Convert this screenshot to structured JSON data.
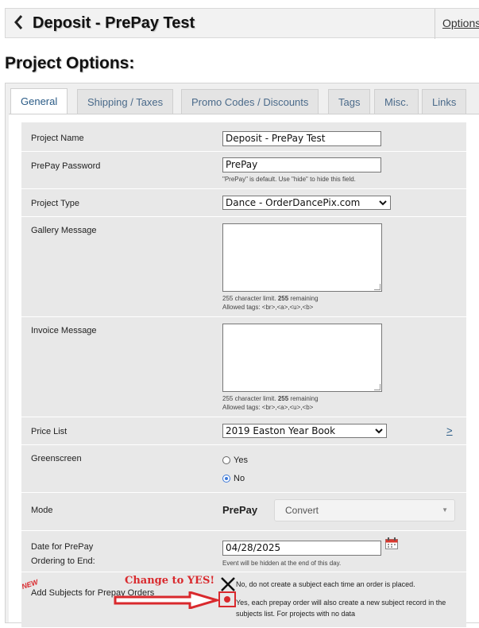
{
  "header": {
    "back_icon": "chevron-left-icon",
    "title": "Deposit - PrePay Test",
    "options_link": "Options"
  },
  "section_title": "Project Options:",
  "tabs": [
    {
      "label": "General",
      "active": true
    },
    {
      "label": "Shipping / Taxes",
      "active": false
    },
    {
      "label": "Promo Codes / Discounts",
      "active": false
    },
    {
      "label": "Tags",
      "active": false
    },
    {
      "label": "Misc.",
      "active": false
    },
    {
      "label": "Links",
      "active": false
    }
  ],
  "form": {
    "project_name": {
      "label": "Project Name",
      "value": "Deposit - PrePay Test"
    },
    "prepay_password": {
      "label": "PrePay Password",
      "value": "PrePay",
      "hint": "\"PrePay\" is default. Use \"hide\" to hide this field."
    },
    "project_type": {
      "label": "Project Type",
      "value": "Dance - OrderDancePix.com"
    },
    "gallery_message": {
      "label": "Gallery Message",
      "limit_prefix": "255 character limit.",
      "remaining_count": "255",
      "remaining_suffix": "remaining",
      "tags": "Allowed tags: <br>,<a>,<u>,<b>"
    },
    "invoice_message": {
      "label": "Invoice Message",
      "limit_prefix": "255 character limit.",
      "remaining_count": "255",
      "remaining_suffix": "remaining",
      "tags": "Allowed tags: <br>,<a>,<u>,<b>"
    },
    "price_list": {
      "label": "Price List",
      "value": "2019 Easton Year Book",
      "link": ">"
    },
    "greenscreen": {
      "label": "Greenscreen",
      "options": [
        {
          "label": "Yes",
          "selected": false
        },
        {
          "label": "No",
          "selected": true
        }
      ]
    },
    "mode": {
      "label": "Mode",
      "value": "PrePay",
      "convert_label": "Convert"
    },
    "date_end": {
      "label_line1": "Date for PrePay",
      "label_line2": "Ordering to End:",
      "value": "04/28/2025",
      "hint": "Event will be hidden at the end of this day."
    },
    "add_subjects": {
      "new_badge": "NEW",
      "label": "Add Subjects for Prepay Orders",
      "option_no": "No, do not create a subject each time an order is placed.",
      "option_yes": "Yes, each prepay order will also create a new subject record in the subjects list. For projects with no data"
    }
  },
  "annotation": {
    "text": "Change to YES!",
    "color": "#d9292d"
  }
}
